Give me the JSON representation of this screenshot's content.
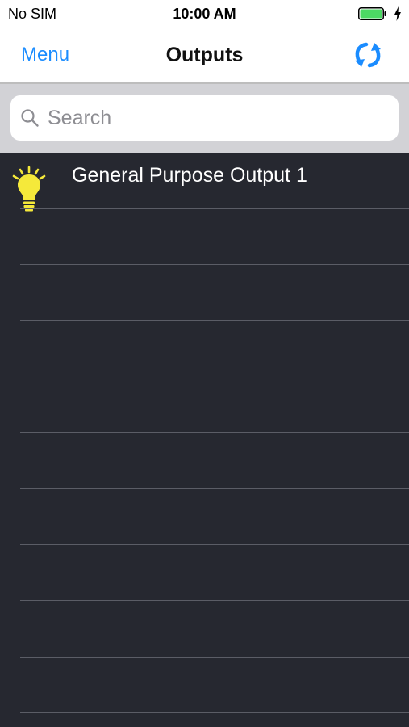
{
  "status_bar": {
    "carrier": "No SIM",
    "time": "10:00 AM",
    "battery_level": 1.0,
    "charging": true,
    "battery_color": "#4cd964"
  },
  "nav": {
    "menu_label": "Menu",
    "title": "Outputs",
    "refresh_icon": "refresh-icon",
    "accent_color": "#1a8cff"
  },
  "search": {
    "placeholder": "Search",
    "value": ""
  },
  "outputs": {
    "items": [
      {
        "label": "General Purpose Output 1",
        "icon": "lightbulb-icon",
        "state": "on",
        "icon_color": "#f5e93a"
      }
    ],
    "empty_row_count": 9,
    "background_color": "#262830"
  }
}
